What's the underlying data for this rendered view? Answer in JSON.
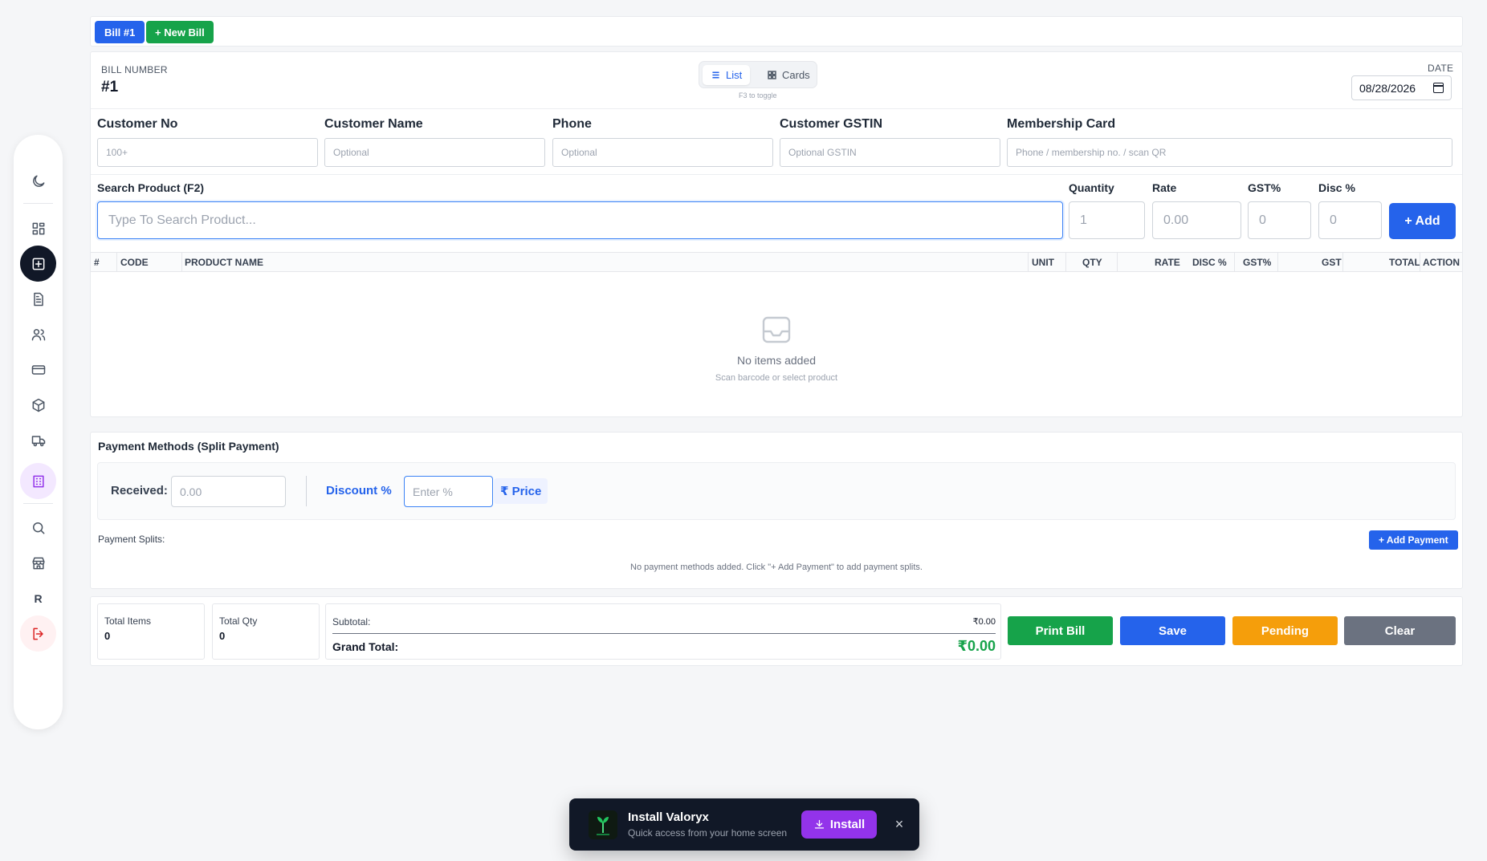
{
  "tabs": {
    "current_bill": "Bill #1",
    "new_bill": "+ New Bill"
  },
  "header": {
    "bill_number_label": "BILL NUMBER",
    "bill_number": "#1",
    "view_list": "List",
    "view_cards": "Cards",
    "toggle_hint": "F3 to toggle",
    "date_label": "DATE",
    "date_value": "08/28/2026"
  },
  "customer": {
    "no_label": "Customer No",
    "no_placeholder": "100+",
    "name_label": "Customer Name",
    "name_placeholder": "Optional",
    "phone_label": "Phone",
    "phone_placeholder": "Optional",
    "gstin_label": "Customer GSTIN",
    "gstin_placeholder": "Optional GSTIN",
    "membership_label": "Membership Card",
    "membership_placeholder": "Phone / membership no. / scan QR"
  },
  "product": {
    "search_label": "Search Product (F2)",
    "search_placeholder": "Type To Search Product...",
    "qty_label": "Quantity",
    "qty_value": "1",
    "rate_label": "Rate",
    "rate_value": "0.00",
    "gst_label": "GST%",
    "gst_value": "0",
    "disc_label": "Disc %",
    "disc_value": "0",
    "add_button": "+ Add"
  },
  "table": {
    "columns": [
      "#",
      "CODE",
      "PRODUCT NAME",
      "UNIT",
      "QTY",
      "RATE",
      "DISC %",
      "GST%",
      "GST",
      "TOTAL",
      "ACTION"
    ],
    "empty_title": "No items added",
    "empty_subtitle": "Scan barcode or select product"
  },
  "payment": {
    "title": "Payment Methods (Split Payment)",
    "received_label": "Received:",
    "received_placeholder": "0.00",
    "discount_label": "Discount %",
    "discount_placeholder": "Enter %",
    "price_button": "₹ Price",
    "splits_label": "Payment Splits:",
    "add_payment": "+ Add Payment",
    "no_payment_text": "No payment methods added. Click \"+ Add Payment\" to add payment splits."
  },
  "summary": {
    "total_items_label": "Total Items",
    "total_items": "0",
    "total_qty_label": "Total Qty",
    "total_qty": "0",
    "subtotal_label": "Subtotal:",
    "subtotal": "₹0.00",
    "grand_total_label": "Grand Total:",
    "grand_total": "₹0.00"
  },
  "actions": {
    "print": "Print Bill",
    "save": "Save",
    "pending": "Pending",
    "clear": "Clear"
  },
  "sidebar": {
    "items": [
      "moon-icon",
      "dashboard-icon",
      "new-bill-icon",
      "document-icon",
      "users-icon",
      "card-icon",
      "package-icon",
      "truck-icon",
      "building-icon",
      "search-icon",
      "store-icon",
      "profile-initial",
      "logout-icon"
    ],
    "profile_initial": "R"
  },
  "install_toast": {
    "title": "Install Valoryx",
    "subtitle": "Quick access from your home screen",
    "button": "Install",
    "close": "×"
  },
  "colors": {
    "primary": "#2563eb",
    "success": "#16a34a",
    "warning": "#f59e0b",
    "neutral": "#6b7280",
    "purple": "#9333ea"
  }
}
